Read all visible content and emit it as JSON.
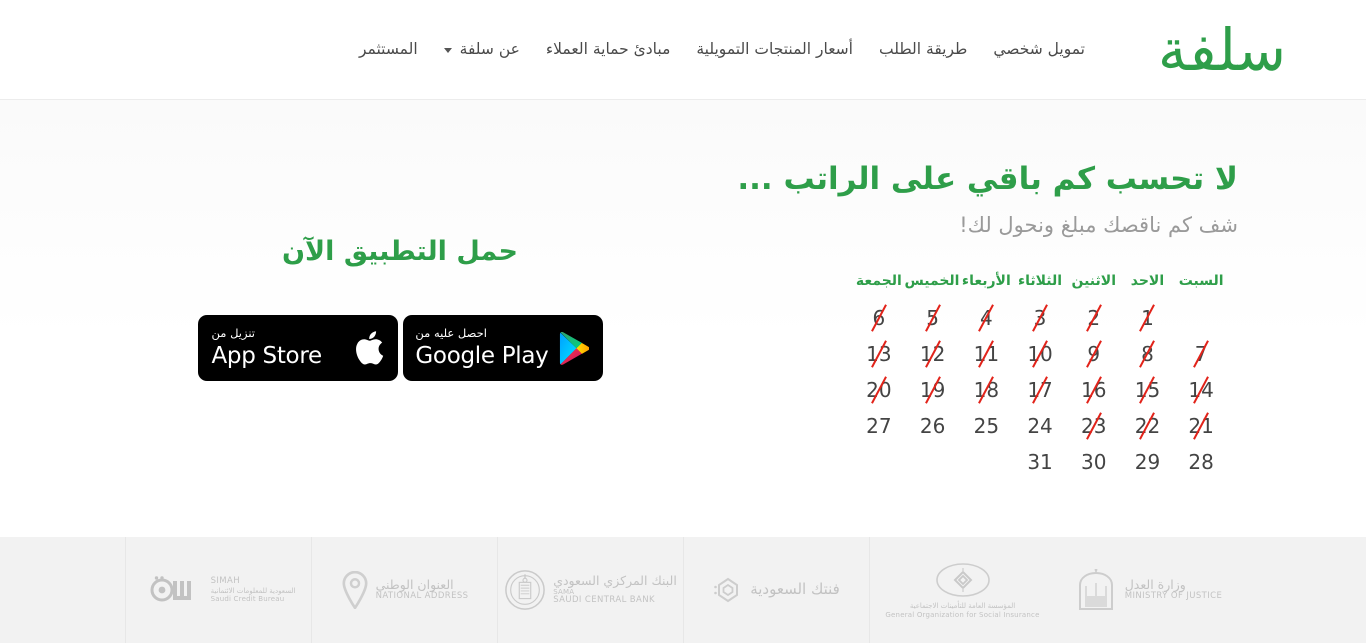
{
  "header": {
    "brand": "سلفة",
    "nav": [
      {
        "label": "تمويل شخصي",
        "dropdown": false
      },
      {
        "label": "طريقة الطلب",
        "dropdown": false
      },
      {
        "label": "أسعار المنتجات التمويلية",
        "dropdown": false
      },
      {
        "label": "مبادئ حماية العملاء",
        "dropdown": false
      },
      {
        "label": "عن سلفة",
        "dropdown": true
      },
      {
        "label": "المستثمر",
        "dropdown": false
      }
    ]
  },
  "hero": {
    "title": "لا تحسب كم باقي على الراتب ...",
    "subtitle": "شف كم ناقصك مبلغ ونحول لك!",
    "accent_color": "#2e9e49",
    "subtitle_color": "#9a9a9a"
  },
  "calendar": {
    "weekday_headers": [
      "السبت",
      "الاحد",
      "الاثنين",
      "الثلاثاء",
      "الأربعاء",
      "الخميس",
      "الجمعة"
    ],
    "strike_color": "#e2231a",
    "header_color": "#2e9e49",
    "weeks": [
      [
        {
          "day": "",
          "struck": false
        },
        {
          "day": "1",
          "struck": true
        },
        {
          "day": "2",
          "struck": true
        },
        {
          "day": "3",
          "struck": true
        },
        {
          "day": "4",
          "struck": true
        },
        {
          "day": "5",
          "struck": true
        },
        {
          "day": "6",
          "struck": true
        }
      ],
      [
        {
          "day": "7",
          "struck": true
        },
        {
          "day": "8",
          "struck": true
        },
        {
          "day": "9",
          "struck": true
        },
        {
          "day": "10",
          "struck": true
        },
        {
          "day": "11",
          "struck": true
        },
        {
          "day": "12",
          "struck": true
        },
        {
          "day": "13",
          "struck": true
        }
      ],
      [
        {
          "day": "14",
          "struck": true
        },
        {
          "day": "15",
          "struck": true
        },
        {
          "day": "16",
          "struck": true
        },
        {
          "day": "17",
          "struck": true
        },
        {
          "day": "18",
          "struck": true
        },
        {
          "day": "19",
          "struck": true
        },
        {
          "day": "20",
          "struck": true
        }
      ],
      [
        {
          "day": "21",
          "struck": true
        },
        {
          "day": "22",
          "struck": true
        },
        {
          "day": "23",
          "struck": true
        },
        {
          "day": "24",
          "struck": false
        },
        {
          "day": "25",
          "struck": false
        },
        {
          "day": "26",
          "struck": false
        },
        {
          "day": "27",
          "struck": false
        }
      ],
      [
        {
          "day": "28",
          "struck": false
        },
        {
          "day": "29",
          "struck": false
        },
        {
          "day": "30",
          "struck": false
        },
        {
          "day": "31",
          "struck": false
        },
        {
          "day": "",
          "struck": false
        },
        {
          "day": "",
          "struck": false
        },
        {
          "day": "",
          "struck": false
        }
      ]
    ]
  },
  "download": {
    "title": "حمل التطبيق الآن",
    "google_play": {
      "top_text": "احصل عليه من",
      "main_text": "Google Play",
      "icon": "google-play-icon"
    },
    "app_store": {
      "top_text": "تنزيل من",
      "main_text": "App Store",
      "icon": "apple-icon"
    }
  },
  "partners": [
    {
      "name_ar": "سمة",
      "sub_ar": "السعودية للمعلومات الائتمانية",
      "name_en": "SIMAH",
      "sub_en": "Saudi Credit Bureau",
      "icon": "simah-logo"
    },
    {
      "name_ar": "العنوان الوطني",
      "name_en": "National Address",
      "icon": "national-address-pin-icon"
    },
    {
      "name_ar": "البنك المركزي السعودي",
      "name_en": "Saudi Central Bank",
      "sub_en": "SAMA",
      "icon": "saudi-central-bank-seal-icon"
    },
    {
      "name_ar": "فنتك السعودية",
      "name_en": "",
      "icon": "fintech-saudi-icon"
    },
    {
      "name_ar": "المؤسسة العامة للتأمينات الاجتماعية",
      "name_en": "General Organization for Social Insurance",
      "icon": "gosi-logo-icon"
    },
    {
      "name_ar": "وزارة العدل",
      "name_en": "Ministry of Justice",
      "icon": "ministry-of-justice-crest-icon"
    }
  ]
}
